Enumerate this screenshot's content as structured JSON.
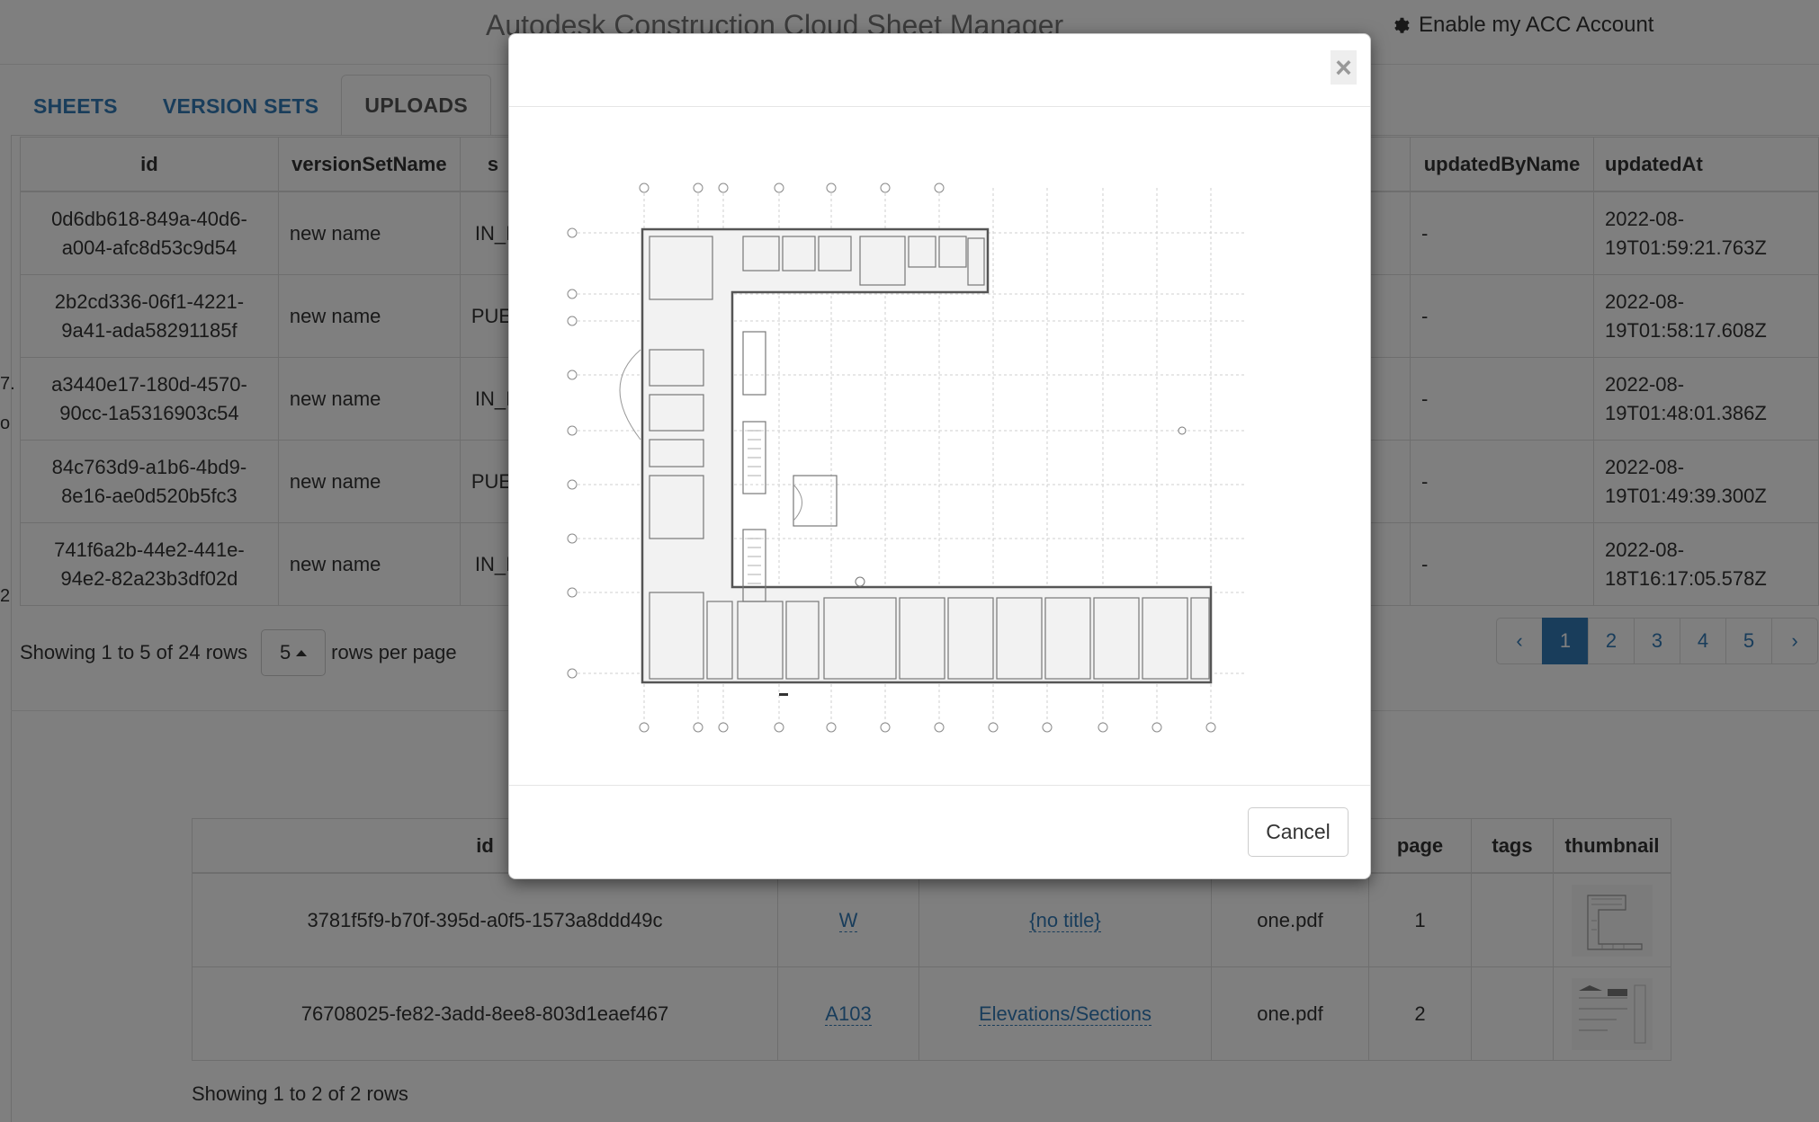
{
  "header": {
    "title": "Autodesk Construction Cloud Sheet Manager",
    "acc_link": "Enable my ACC Account"
  },
  "tabs": [
    {
      "label": "SHEETS",
      "active": false
    },
    {
      "label": "VERSION SETS",
      "active": false
    },
    {
      "label": "UPLOADS",
      "active": true
    }
  ],
  "uploads_table": {
    "columns": [
      "id",
      "versionSetName",
      "s",
      "updatedByName",
      "updatedAt"
    ],
    "rows": [
      {
        "id": [
          "0d6db618-849a-40d6-",
          "a004-afc8d53c9d54"
        ],
        "versionSetName": "new name",
        "status": "IN_I",
        "updatedByName": "-",
        "updatedAt": [
          "2022-08-",
          "19T01:59:21.763Z"
        ]
      },
      {
        "id": [
          "2b2cd336-06f1-4221-",
          "9a41-ada58291185f"
        ],
        "versionSetName": "new name",
        "status": "PUE",
        "updatedByName": "-",
        "updatedAt": [
          "2022-08-",
          "19T01:58:17.608Z"
        ]
      },
      {
        "id": [
          "a3440e17-180d-4570-",
          "90cc-1a5316903c54"
        ],
        "versionSetName": "new name",
        "status": "IN_I",
        "updatedByName": "-",
        "updatedAt": [
          "2022-08-",
          "19T01:48:01.386Z"
        ]
      },
      {
        "id": [
          "84c763d9-a1b6-4bd9-",
          "8e16-ae0d520b5fc3"
        ],
        "versionSetName": "new name",
        "status": "PUE",
        "updatedByName": "-",
        "updatedAt": [
          "2022-08-",
          "19T01:49:39.300Z"
        ]
      },
      {
        "id": [
          "741f6a2b-44e2-441e-",
          "94e2-82a23b3df02d"
        ],
        "versionSetName": "new name",
        "status": "IN_I",
        "updatedByName": "-",
        "updatedAt": [
          "2022-08-",
          "18T16:17:05.578Z"
        ]
      }
    ],
    "edge_chars": [
      "7.",
      "o",
      "2"
    ]
  },
  "pagination": {
    "showing_text": "Showing 1 to 5 of 24 rows",
    "page_size": "5",
    "rows_per_page_label": "rows per page",
    "prev": "‹",
    "pages": [
      "1",
      "2",
      "3",
      "4",
      "5"
    ],
    "active_page": "1",
    "next": "›"
  },
  "sheets_table": {
    "columns": [
      "id",
      "",
      "",
      "",
      "page",
      "tags",
      "thumbnail"
    ],
    "rows": [
      {
        "id": "3781f5f9-b70f-395d-a0f5-1573a8ddd49c",
        "number": "W",
        "title": "{no title}",
        "file": "one.pdf",
        "page": "1",
        "tags": "",
        "thumbnail_icon": "floor-plan-thumbnail"
      },
      {
        "id": "76708025-fe82-3add-8ee8-803d1eaef467",
        "number": "A103",
        "title": "Elevations/Sections",
        "file": "one.pdf",
        "page": "2",
        "tags": "",
        "thumbnail_icon": "elevations-thumbnail"
      }
    ],
    "showing_text": "Showing 1 to 2 of 2 rows"
  },
  "modal": {
    "close_label": "×",
    "preview_icon": "floor-plan-preview",
    "cancel_label": "Cancel"
  },
  "colors": {
    "link": "#337ab7",
    "active_page_bg": "#337ab7",
    "backdrop": "rgba(0,0,0,0.5)"
  }
}
